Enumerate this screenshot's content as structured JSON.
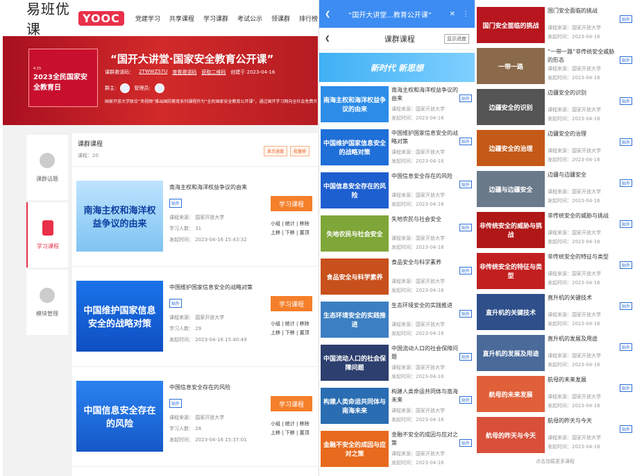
{
  "site": {
    "logo_text": "易班优课",
    "logo_badge": "YOOC",
    "nav": [
      "党建学习",
      "共享课程",
      "学习课群",
      "考试公示",
      "领课群",
      "排行榜"
    ]
  },
  "hero": {
    "img_title": "2023全民国家安全教育日",
    "img_sub": "4.15",
    "title": "“国开大讲堂·国家安全教育公开课”",
    "code_label": "课群邀请码：",
    "code": "2TWWZS7U",
    "qr": "查看邀请码",
    "share": "获取二维码",
    "created": "创建于 2023-04-16",
    "owner_label": "群主:",
    "admin_label": "管理员:",
    "desc": "国家开放大学联合“央视频”推出国防教育系列课程作为“全民国家安全教育公开课”，通过国开学习网向全社会免费开放..."
  },
  "sidenav": [
    {
      "label": "课群话题"
    },
    {
      "label": "学习课程"
    },
    {
      "label": "模块管理"
    }
  ],
  "panelA": {
    "head_title": "课群课程",
    "head_count": "课程：20",
    "btn1": "显示进度",
    "btn2": "批量移",
    "courses": [
      {
        "img": "南海主权和海洋权益争议的由来",
        "title": "南海主权和海洋权益争议的由来",
        "tag": "贴外",
        "source": "课程来源：  国家开放大学",
        "learners": "学习人数：  31",
        "time": "发起时间：  2023-04-16 15:43:32",
        "btn": "学习课程",
        "ops1": "小组 | 统计 | 移除",
        "ops2": "上移 | 下移 | 置顶"
      },
      {
        "img": "中国维护国家信息安全的战略对策",
        "title": "中国维护国家信息安全的战略对策",
        "tag": "贴外",
        "source": "课程来源：  国家开放大学",
        "learners": "学习人数：  29",
        "time": "发起时间：  2023-04-16 15:40:49",
        "btn": "学习课程",
        "ops1": "小组 | 统计 | 移除",
        "ops2": "上移 | 下移 | 置顶"
      },
      {
        "img": "中国信息安全存在的风险",
        "title": "中国信息安全存在的风险",
        "tag": "贴外",
        "source": "课程来源：  国家开放大学",
        "learners": "学习人数：  28",
        "time": "发起时间：  2023-04-16 15:37:01",
        "btn": "学习课程",
        "ops1": "小组 | 统计 | 移除",
        "ops2": "上移 | 下移 | 置顶"
      }
    ]
  },
  "panelB": {
    "browser_title": "“国开大讲堂...教育公开课”",
    "page_title": "课群课程",
    "progress_btn": "显示进度",
    "banner": "新时代 新思想",
    "items": [
      {
        "thumb": "南海主权和海洋权益争议的由来",
        "title": "南海主权和海洋权益争议的由来",
        "src": "课程来源：国家开放大学",
        "time": "发起时间：2023-04-16",
        "tag": "贴外",
        "color": "#2d8ce8"
      },
      {
        "thumb": "中国维护国家信息安全的战略对策",
        "title": "中国维护国家信息安全的战略对策",
        "src": "课程来源：国家开放大学",
        "time": "发起时间：2023-04-16",
        "tag": "贴外",
        "color": "#1f6fd8"
      },
      {
        "thumb": "中国信息安全存在的风险",
        "title": "中国信息安全存在的风险",
        "src": "课程来源：国家开放大学",
        "time": "发起时间：2023-04-16",
        "tag": "贴外",
        "color": "#1e5fcf"
      },
      {
        "thumb": "失地农民与社会安全",
        "title": "失地农民与社会安全",
        "src": "课程来源：国家开放大学",
        "time": "发起时间：2023-04-16",
        "tag": "贴外",
        "color": "#7ea638"
      },
      {
        "thumb": "食品安全与科学素养",
        "title": "食品安全与科学素养",
        "src": "课程来源：国家开放大学",
        "time": "发起时间：2023-04-16",
        "tag": "贴外",
        "color": "#c8501c"
      },
      {
        "thumb": "生态环境安全的实践推进",
        "title": "生态环境安全的实践推进",
        "src": "课程来源：国家开放大学",
        "time": "发起时间：2023-04-16",
        "tag": "贴外",
        "color": "#3c7fc2"
      },
      {
        "thumb": "中国流动人口的社会保障问题",
        "title": "中国流动人口的社会保障问题",
        "src": "课程来源：国家开放大学",
        "time": "发起时间：2023-04-16",
        "tag": "贴外",
        "color": "#2d3f6e"
      },
      {
        "thumb": "构建人类命运共同体与南海未来",
        "title": "构建人类命运共同体与南海未来",
        "src": "课程来源：国家开放大学",
        "time": "发起时间：2023-04-16",
        "tag": "贴外",
        "color": "#2a6db2"
      },
      {
        "thumb": "金融不安全的成因与应对之策",
        "title": "金融不安全的成因与应对之策",
        "src": "课程来源：国家开放大学",
        "time": "发起时间：2023-04-16",
        "tag": "贴外",
        "color": "#e86a1e"
      }
    ]
  },
  "panelC": {
    "load_more": "点击加载更多课程",
    "items": [
      {
        "thumb": "国门安全面临的挑战",
        "title": "国门安全面临的挑战",
        "src": "课程来源：国家开放大学",
        "time": "发起时间：2023-04-16",
        "tag": "贴外",
        "color": "#b8161e"
      },
      {
        "thumb": "一带一路",
        "title": "“一带一路”非传统安全威胁的形态",
        "src": "课程来源：国家开放大学",
        "time": "发起时间：2023-04-16",
        "tag": "贴外",
        "color": "#8a6a4a"
      },
      {
        "thumb": "边疆安全的识别",
        "title": "边疆安全的识别",
        "src": "课程来源：国家开放大学",
        "time": "发起时间：2023-04-16",
        "tag": "贴外",
        "color": "#555"
      },
      {
        "thumb": "边疆安全的治理",
        "title": "边疆安全的治理",
        "src": "课程来源：国家开放大学",
        "time": "发起时间：2023-04-16",
        "tag": "贴外",
        "color": "#c45a18"
      },
      {
        "thumb": "边疆与边疆安全",
        "title": "边疆与边疆安全",
        "src": "课程来源：国家开放大学",
        "time": "发起时间：2023-04-16",
        "tag": "贴外",
        "color": "#6a7a8a"
      },
      {
        "thumb": "非传统安全的威胁与挑战",
        "title": "非传统安全的威胁与挑战",
        "src": "课程来源：国家开放大学",
        "time": "发起时间：2023-04-16",
        "tag": "贴外",
        "color": "#b01818"
      },
      {
        "thumb": "非传统安全的特征与类型",
        "title": "非传统安全的特征与类型",
        "src": "课程来源：国家开放大学",
        "time": "发起时间：2023-04-16",
        "tag": "贴外",
        "color": "#c22020"
      },
      {
        "thumb": "直升机的关键技术",
        "title": "直升机的关键技术",
        "src": "课程来源：国家开放大学",
        "time": "发起时间：2023-04-16",
        "tag": "贴外",
        "color": "#2e4f8a"
      },
      {
        "thumb": "直升机的发展及用途",
        "title": "直升机的发展及用途",
        "src": "课程来源：国家开放大学",
        "time": "发起时间：2023-04-16",
        "tag": "贴外",
        "color": "#4a6a9a"
      },
      {
        "thumb": "航母的未来发展",
        "title": "航母的未来发展",
        "src": "课程来源：国家开放大学",
        "time": "发起时间：2023-04-16",
        "tag": "贴外",
        "color": "#e0603a"
      },
      {
        "thumb": "航母的昨天与今天",
        "title": "航母的昨天与今天",
        "src": "课程来源：国家开放大学",
        "time": "发起时间：2023-04-16",
        "tag": "贴外",
        "color": "#d8503a"
      }
    ]
  }
}
